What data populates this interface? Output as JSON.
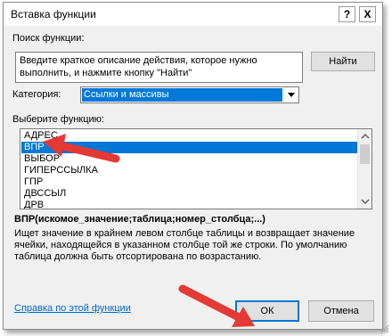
{
  "dialog": {
    "title": "Вставка функции",
    "help_button": "?",
    "close_button": "X"
  },
  "search": {
    "label": "Поиск функции:",
    "description": "Введите краткое описание действия, которое нужно выполнить, и нажмите кнопку \"Найти\"",
    "find_button": "Найти"
  },
  "category": {
    "label": "Категория:",
    "selected": "Ссылки и массивы"
  },
  "function_list": {
    "label": "Выберите функцию:",
    "items": [
      "АДРЕС",
      "ВПР",
      "ВЫБОР",
      "ГИПЕРССЫЛКА",
      "ГПР",
      "ДВССЫЛ",
      "ДРВ"
    ],
    "selected_index": 1
  },
  "details": {
    "syntax": "ВПР(искомое_значение;таблица;номер_столбца;...)",
    "description": "Ищет значение в крайнем левом столбце таблицы и возвращает значение ячейки, находящейся в указанном столбце той же строки. По умолчанию таблица должна быть отсортирована по возрастанию."
  },
  "footer": {
    "help_link": "Справка по этой функции",
    "ok_button": "ОК",
    "cancel_button": "Отмена"
  },
  "colors": {
    "selection": "#0078d7",
    "annotation_arrow": "#e53935",
    "link": "#0066cc"
  }
}
